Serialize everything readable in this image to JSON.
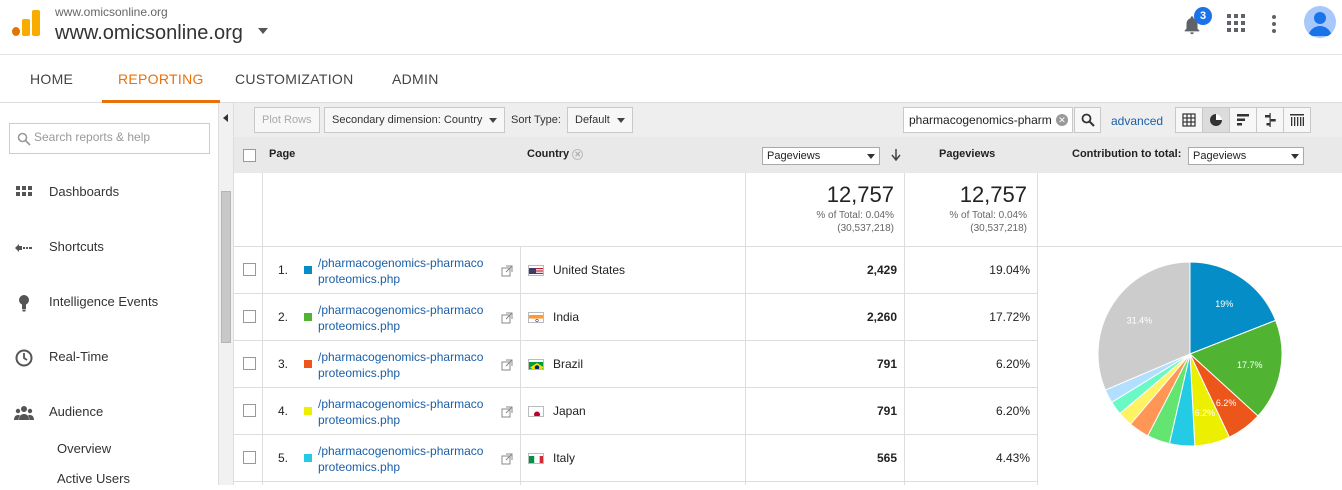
{
  "header": {
    "site_small": "www.omicsonline.org",
    "site_main": "www.omicsonline.org",
    "notifications_count": "3",
    "brand_color": "#f9ab00"
  },
  "nav": {
    "tabs": [
      {
        "label": "HOME",
        "active": false
      },
      {
        "label": "REPORTING",
        "active": true
      },
      {
        "label": "CUSTOMIZATION",
        "active": false
      },
      {
        "label": "ADMIN",
        "active": false
      }
    ],
    "accent_color": "#e8710a"
  },
  "sidebar": {
    "search_placeholder": "Search reports & help",
    "items": [
      {
        "label": "Dashboards",
        "icon": "grid-icon"
      },
      {
        "label": "Shortcuts",
        "icon": "shortcut-arrow-icon"
      },
      {
        "label": "Intelligence Events",
        "icon": "lightbulb-icon"
      },
      {
        "label": "Real-Time",
        "icon": "clock-icon"
      },
      {
        "label": "Audience",
        "icon": "people-icon"
      }
    ],
    "subitems": [
      "Overview",
      "Active Users"
    ]
  },
  "toolbar": {
    "plot_rows": "Plot Rows",
    "secondary_dimension": "Secondary dimension: Country",
    "sort_type_label": "Sort Type:",
    "sort_type_value": "Default",
    "filter_value": "pharmacogenomics-pharm",
    "advanced": "advanced"
  },
  "table": {
    "headers": {
      "page": "Page",
      "country": "Country",
      "metric_select": "Pageviews",
      "pageviews": "Pageviews",
      "contribution_label": "Contribution to total:",
      "contribution_select": "Pageviews"
    },
    "totals": [
      {
        "value": "12,757",
        "pct": "% of Total: 0.04%",
        "abs": "(30,537,218)"
      },
      {
        "value": "12,757",
        "pct": "% of Total: 0.04%",
        "abs": "(30,537,218)"
      }
    ],
    "rows": [
      {
        "num": "1.",
        "color": "#058dc7",
        "page_line1": "/pharmacogenomics-pharmaco",
        "page_line2": "proteomics.php",
        "country": "United States",
        "flag": "us",
        "pageviews": "2,429",
        "percent": "19.04%"
      },
      {
        "num": "2.",
        "color": "#50b432",
        "page_line1": "/pharmacogenomics-pharmaco",
        "page_line2": "proteomics.php",
        "country": "India",
        "flag": "in",
        "pageviews": "2,260",
        "percent": "17.72%"
      },
      {
        "num": "3.",
        "color": "#ed561b",
        "page_line1": "/pharmacogenomics-pharmaco",
        "page_line2": "proteomics.php",
        "country": "Brazil",
        "flag": "br",
        "pageviews": "791",
        "percent": "6.20%"
      },
      {
        "num": "4.",
        "color": "#edef00",
        "page_line1": "/pharmacogenomics-pharmaco",
        "page_line2": "proteomics.php",
        "country": "Japan",
        "flag": "jp",
        "pageviews": "791",
        "percent": "6.20%"
      },
      {
        "num": "5.",
        "color": "#24cbe5",
        "page_line1": "/pharmacogenomics-pharmaco",
        "page_line2": "proteomics.php",
        "country": "Italy",
        "flag": "it",
        "pageviews": "565",
        "percent": "4.43%"
      }
    ]
  },
  "chart_data": {
    "type": "pie",
    "slices": [
      {
        "value": 19.04,
        "color": "#058dc7",
        "label": "19%"
      },
      {
        "value": 17.72,
        "color": "#50b432",
        "label": "17.7%"
      },
      {
        "value": 6.2,
        "color": "#ed561b",
        "label": "6.2%"
      },
      {
        "value": 6.2,
        "color": "#edef00",
        "label": "6.2%"
      },
      {
        "value": 4.43,
        "color": "#24cbe5",
        "label": ""
      },
      {
        "value": 4.0,
        "color": "#64e572",
        "label": ""
      },
      {
        "value": 3.6,
        "color": "#ff9655",
        "label": ""
      },
      {
        "value": 2.6,
        "color": "#fff263",
        "label": ""
      },
      {
        "value": 2.4,
        "color": "#6af9c4",
        "label": ""
      },
      {
        "value": 2.4,
        "color": "#b2deff",
        "label": ""
      },
      {
        "value": 31.4,
        "color": "#cccccc",
        "label": "31.4%"
      }
    ]
  }
}
